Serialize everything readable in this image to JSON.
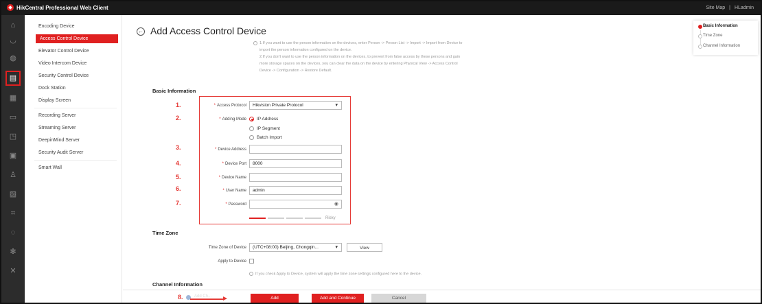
{
  "app": {
    "title": "HikCentral Professional Web Client"
  },
  "topbar": {
    "site_map": "Site Map",
    "separator": "|",
    "user": "HLadmin"
  },
  "rail": {
    "icons": [
      "home-icon",
      "shield-icon",
      "globe-icon",
      "device-icon",
      "panel-icon",
      "document-icon",
      "crop-icon",
      "calendar-icon",
      "person-icon",
      "image-icon",
      "scan-icon",
      "check-icon",
      "gear-icon",
      "tools-icon"
    ],
    "active_index": 3
  },
  "sidebar": {
    "items": [
      "Encoding Device",
      "Access Control Device",
      "Elevator Control Device",
      "Video Intercom Device",
      "Security Control Device",
      "Dock Station",
      "Display Screen",
      "Recording Server",
      "Streaming Server",
      "DeepinMind Server",
      "Security Audit Server",
      "Smart Wall"
    ],
    "active_index": 1
  },
  "page": {
    "title": "Add Access Control Device",
    "note1_line1": "1.If you want to use the person information on the devices, enter Person -> Person List -> Import -> Import from Device to",
    "note1_line2": "import the person information configured on the device.",
    "note2_line1": "2.If you don't want to use the person information on the devices, to prevent from false access by these persons and gain",
    "note2_line2": "more storage spaces on the devices, you can clear the data on the device by entering Physical View -> Access Control",
    "note2_line3": "Device -> Configuration -> Restore Default."
  },
  "basic": {
    "section": "Basic Information",
    "protocol_label": "Access Protocol",
    "protocol_value": "Hikvision Private Protocol",
    "adding_mode_label": "Adding Mode",
    "modes": [
      "IP Address",
      "IP Segment",
      "Batch Import"
    ],
    "device_address_label": "Device Address",
    "device_address_value": "",
    "device_port_label": "Device Port",
    "device_port_value": "8000",
    "device_name_label": "Device Name",
    "device_name_value": "",
    "user_name_label": "User Name",
    "user_name_value": "admin",
    "password_label": "Password",
    "password_value": "",
    "strength_label": "Risky",
    "strength_level": 1,
    "strength_total": 4
  },
  "annotations": [
    "1.",
    "2.",
    "3.",
    "4.",
    "5.",
    "6.",
    "7.",
    "8."
  ],
  "timezone": {
    "section": "Time Zone",
    "tz_label": "Time Zone of Device",
    "tz_value": "(UTC+08:00) Beijing, Chongqin...",
    "view_button": "View",
    "apply_label": "Apply to Device",
    "note": "If you check Apply to Device, system will apply the time zone settings configured here to the device."
  },
  "channel": {
    "section": "Channel Information"
  },
  "footer": {
    "hidden_label": "Add Ch...",
    "add": "Add",
    "add_continue": "Add and Continue",
    "cancel": "Cancel"
  },
  "anchor": {
    "items": [
      "Basic Information",
      "Time Zone",
      "Channel Information"
    ],
    "active_index": 0
  },
  "colors": {
    "accent": "#e02020",
    "annotation": "#e53935",
    "rail": "#2c2c2c",
    "topbar": "#1a1a1a"
  }
}
